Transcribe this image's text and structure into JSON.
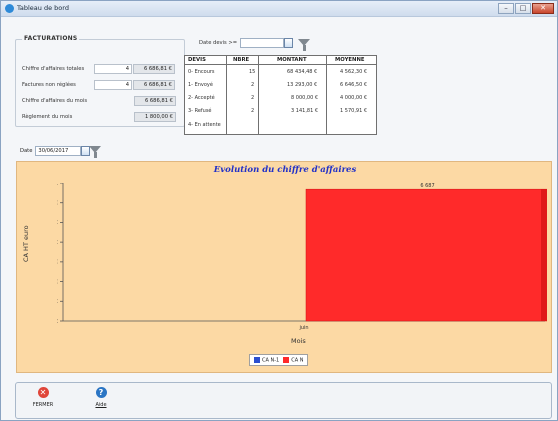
{
  "window": {
    "title": "Tableau de bord",
    "controls": {
      "minimize": "–",
      "maximize": "□",
      "close": "✕"
    }
  },
  "facturations": {
    "legend": "FACTURATIONS",
    "rows": [
      {
        "label": "Chiffre d'affaires totales",
        "count": "4",
        "amount": "6 686,81 €"
      },
      {
        "label": "Factures non réglées",
        "count": "4",
        "amount": "6 686,81 €"
      },
      {
        "label": "Chiffre d'affaires du mois",
        "count": "",
        "amount": "6 686,81 €"
      },
      {
        "label": "Règlement du mois",
        "count": "",
        "amount": "1 800,00 €"
      }
    ]
  },
  "date_devis": {
    "label": "Date devis >=",
    "value": ""
  },
  "devis_table": {
    "headers": [
      "DEVIS",
      "NBRE",
      "MONTANT",
      "MOYENNE"
    ],
    "rows": [
      {
        "devis": "0- Encours",
        "nbre": "15",
        "montant": "68 434,48 €",
        "moyenne": "4 562,30 €"
      },
      {
        "devis": "1- Envoyé",
        "nbre": "2",
        "montant": "13 293,00 €",
        "moyenne": "6 646,50 €"
      },
      {
        "devis": "2- Accepté",
        "nbre": "2",
        "montant": "8 000,00 €",
        "moyenne": "4 000,00 €"
      },
      {
        "devis": "3- Refusé",
        "nbre": "2",
        "montant": "3 141,81 €",
        "moyenne": "1 570,91 €"
      },
      {
        "devis": "4- En attente",
        "nbre": "",
        "montant": "",
        "moyenne": ""
      }
    ]
  },
  "date_filter": {
    "label": "Date",
    "value": "30/06/2017"
  },
  "colors": {
    "chart_bg": "#fcd9a4",
    "bar_n": "#ff2a2a",
    "bar_n1": "#2b4fd0",
    "title": "#2030c8"
  },
  "chart_data": {
    "type": "bar",
    "title": "Evolution du chiffre d'affaires",
    "xlabel": "Mois",
    "ylabel": "CA HT euro",
    "categories": [
      "juin"
    ],
    "series": [
      {
        "name": "CA N-1",
        "values": [
          0
        ]
      },
      {
        "name": "CA N",
        "values": [
          6687
        ]
      }
    ],
    "data_labels": [
      "6 687"
    ],
    "yticks": [
      "0 €",
      "1 000 €",
      "2 000 €",
      "3 000 €",
      "4 000 €",
      "5 000 €",
      "6 000 €",
      "7 000 €"
    ],
    "ylim": [
      0,
      7000
    ],
    "grid": false,
    "legend_position": "bottom-center"
  },
  "toolbar": {
    "close_label": "FERMER",
    "help_label": "Aide",
    "close_icon": "close-circle-icon",
    "help_icon": "help-circle-icon"
  }
}
